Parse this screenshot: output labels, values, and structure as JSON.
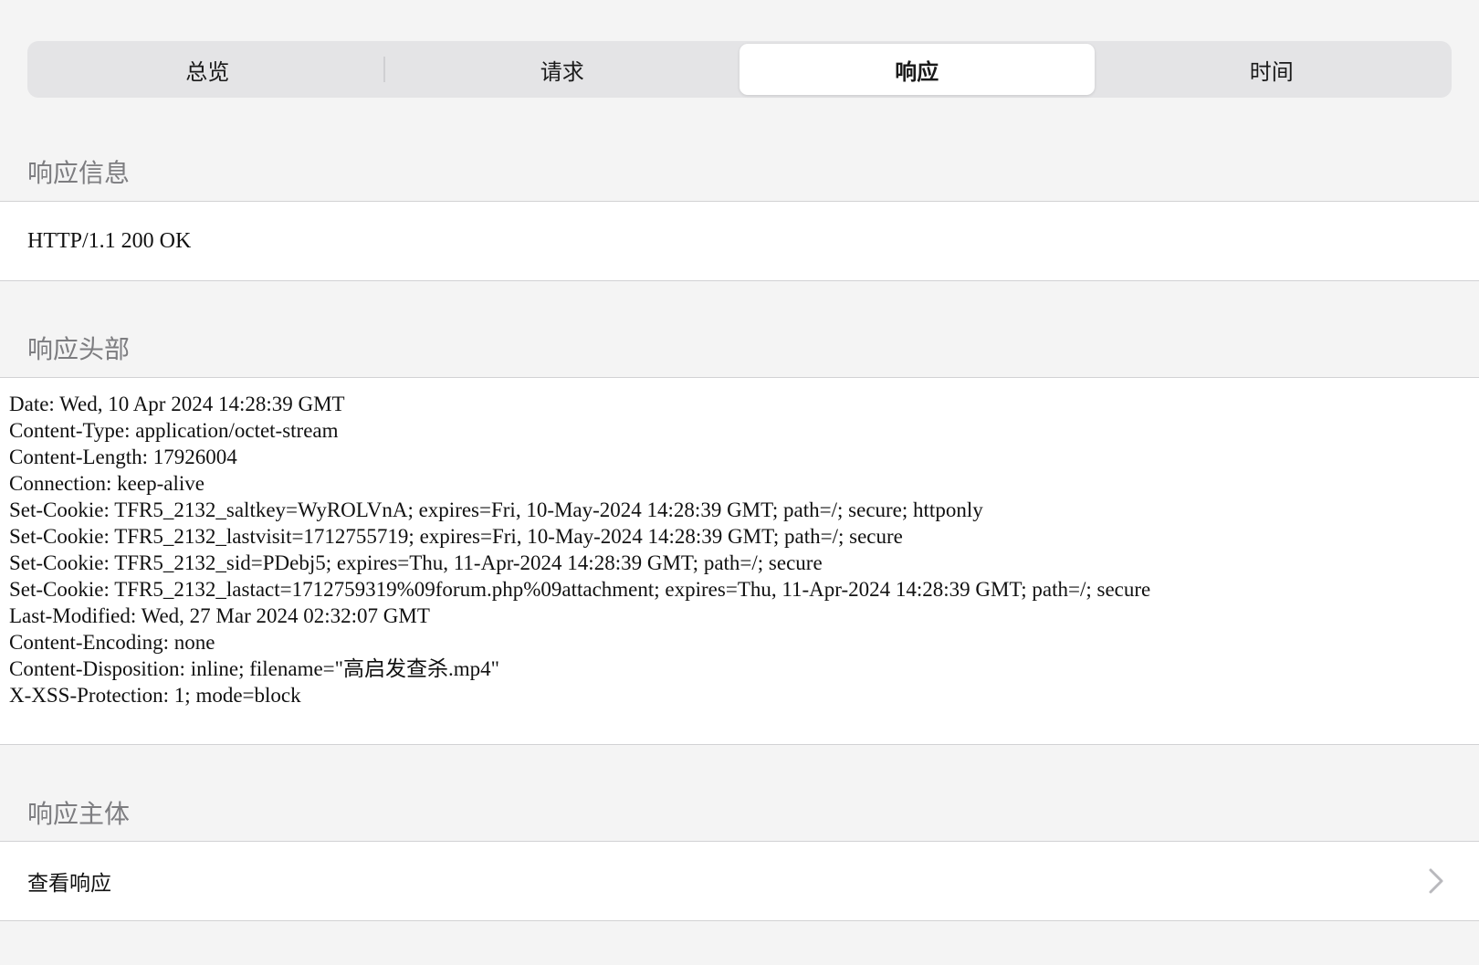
{
  "tabs": [
    {
      "label": "总览",
      "active": false
    },
    {
      "label": "请求",
      "active": false
    },
    {
      "label": "响应",
      "active": true
    },
    {
      "label": "时间",
      "active": false
    }
  ],
  "sections": {
    "response_info": {
      "title": "响应信息",
      "status": "HTTP/1.1 200 OK"
    },
    "response_headers": {
      "title": "响应头部",
      "lines": [
        "Date: Wed, 10 Apr 2024 14:28:39 GMT",
        "Content-Type: application/octet-stream",
        "Content-Length: 17926004",
        "Connection: keep-alive",
        "Set-Cookie: TFR5_2132_saltkey=WyROLVnA; expires=Fri, 10-May-2024 14:28:39 GMT; path=/; secure; httponly",
        "Set-Cookie: TFR5_2132_lastvisit=1712755719; expires=Fri, 10-May-2024 14:28:39 GMT; path=/; secure",
        "Set-Cookie: TFR5_2132_sid=PDebj5; expires=Thu, 11-Apr-2024 14:28:39 GMT; path=/; secure",
        "Set-Cookie: TFR5_2132_lastact=1712759319%09forum.php%09attachment; expires=Thu, 11-Apr-2024 14:28:39 GMT; path=/; secure",
        "Last-Modified: Wed, 27 Mar 2024 02:32:07 GMT",
        "Content-Encoding: none",
        "Content-Disposition: inline; filename=\"高启发查杀.mp4\"",
        "X-XSS-Protection: 1; mode=block"
      ]
    },
    "response_body": {
      "title": "响应主体",
      "view_label": "查看响应",
      "icon": "chevron-right-icon"
    }
  }
}
